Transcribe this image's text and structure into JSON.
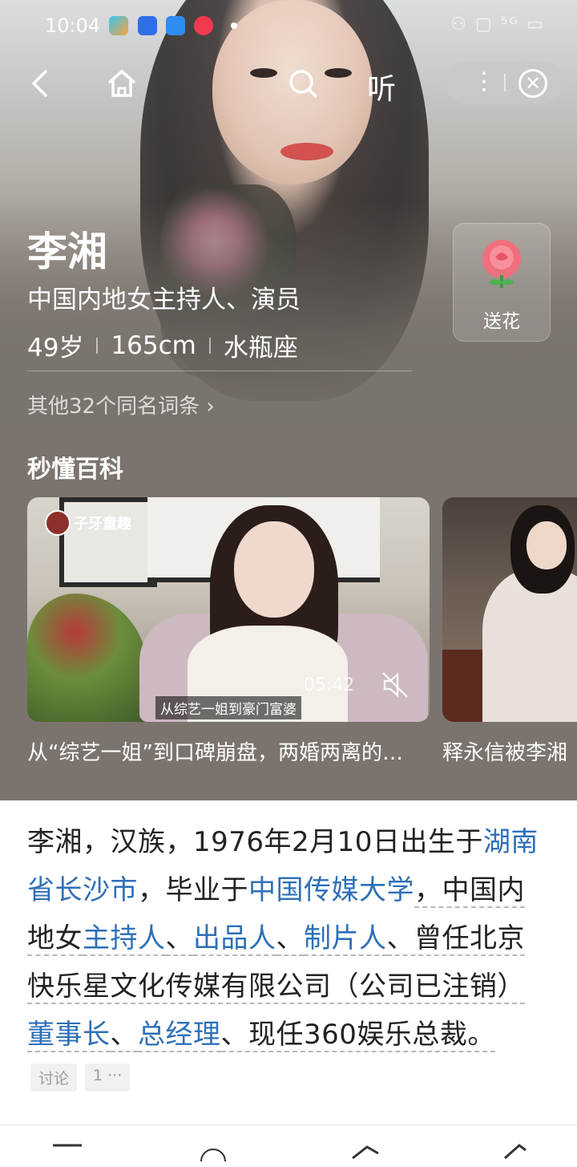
{
  "status_bar": {
    "time": "10:04",
    "right_indicators": "⚇ ▢ ⁵ᴳ ▭"
  },
  "nav": {
    "back_icon": "chevron-left-icon",
    "home_icon": "home-icon",
    "search_icon": "search-icon",
    "listen_label": "听",
    "more_icon": "more-dots-icon",
    "close_icon": "close-circle-icon"
  },
  "profile": {
    "name": "李湘",
    "description": "中国内地女主持人、演员",
    "age": "49岁",
    "height": "165cm",
    "zodiac": "水瓶座",
    "other_entries": "其他32个同名词条 ›"
  },
  "flower": {
    "label": "送花"
  },
  "section": {
    "title": "秒懂百科"
  },
  "videos": [
    {
      "logo_text": "子牙童趣",
      "duration": "05:42",
      "subtitle": "从综艺一姐到豪门富婆",
      "caption": "从“综艺一姐”到口碑崩盘，两婚两离的…"
    },
    {
      "caption": "释永信被李湘"
    }
  ],
  "summary": {
    "p1": "李湘，汉族，1976年2月10日出生于",
    "l1": "湖南省长沙市",
    "p2": "，毕业于",
    "l2": "中国传媒大学",
    "p3": "，中国内地女",
    "l3": "主持人",
    "p4": "、",
    "l4": "出品人",
    "p5": "、",
    "l5": "制片人",
    "p6": "、曾任北京快乐星文化传媒有限公司（公司已注销）",
    "l6": "董事长",
    "p7": "、",
    "l7": "总经理",
    "p8": "、现任360娱乐总裁。"
  },
  "tags": {
    "discuss": "讨论",
    "count": "1 ···"
  },
  "colors": {
    "link": "#2e6fb7",
    "hero_bg": "#7b746e"
  }
}
